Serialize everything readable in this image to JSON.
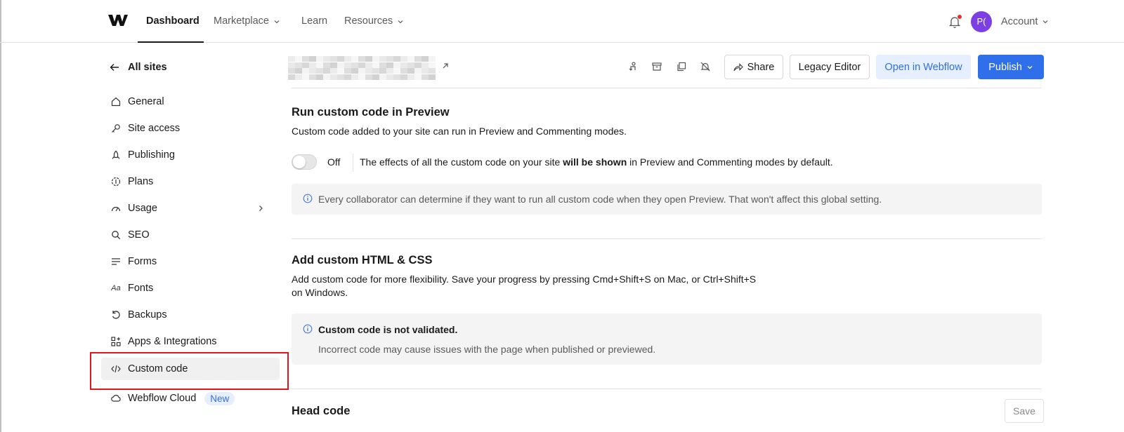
{
  "nav": {
    "logo": "webflow-logo",
    "items": [
      {
        "label": "Dashboard"
      },
      {
        "label": "Marketplace"
      },
      {
        "label": "Learn"
      },
      {
        "label": "Resources"
      }
    ],
    "avatar_initials": "P(",
    "account_label": "Account"
  },
  "sidebar": {
    "back_label": "All sites",
    "items": [
      {
        "label": "General",
        "icon": "home-icon"
      },
      {
        "label": "Site access",
        "icon": "key-icon"
      },
      {
        "label": "Publishing",
        "icon": "rocket-icon"
      },
      {
        "label": "Plans",
        "icon": "plans-icon"
      },
      {
        "label": "Usage",
        "icon": "gauge-icon"
      },
      {
        "label": "SEO",
        "icon": "search-icon"
      },
      {
        "label": "Forms",
        "icon": "forms-icon"
      },
      {
        "label": "Fonts",
        "icon": "fonts-icon"
      },
      {
        "label": "Backups",
        "icon": "backup-icon"
      },
      {
        "label": "Apps & Integrations",
        "icon": "apps-icon"
      },
      {
        "label": "Custom code",
        "icon": "code-icon"
      },
      {
        "label": "Webflow Cloud",
        "icon": "cloud-icon"
      }
    ],
    "new_badge": "New",
    "selected": "Custom code"
  },
  "header": {
    "share_label": "Share",
    "legacy_label": "Legacy Editor",
    "open_label": "Open in Webflow",
    "publish_label": "Publish"
  },
  "preview_section": {
    "title": "Run custom code in Preview",
    "description": "Custom code added to your site can run in Preview and Commenting modes.",
    "toggle_state": "Off",
    "toggle_desc_pre": "The effects of all the custom code on your site ",
    "toggle_desc_bold": "will be shown",
    "toggle_desc_post": " in Preview and Commenting modes by default.",
    "notice": "Every collaborator can determine if they want to run all custom code when they open Preview. That won't affect this global setting."
  },
  "html_css_section": {
    "title": "Add custom HTML & CSS",
    "description_line1": "Add custom code for more flexibility. Save your progress by pressing Cmd+Shift+S on Mac, or Ctrl+Shift+S",
    "description_line2": "on Windows.",
    "notice_title": "Custom code is not validated.",
    "notice_text": "Incorrect code may cause issues with the page when published or previewed."
  },
  "head_code": {
    "title": "Head code",
    "save_label": "Save"
  },
  "colors": {
    "accent": "#2f6fe9",
    "highlight": "#e5131b",
    "avatar": "#7b3fe4"
  }
}
